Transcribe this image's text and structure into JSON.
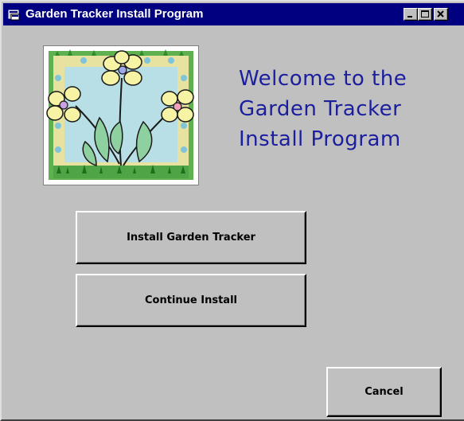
{
  "window": {
    "title": "Garden Tracker Install Program",
    "title_bg": "#000080",
    "face": "#c0c0c0"
  },
  "titlebar_buttons": {
    "minimize_icon": "minimize-icon",
    "maximize_icon": "maximize-icon",
    "close_icon": "close-icon"
  },
  "welcome": {
    "text": "Welcome to the\nGarden Tracker\nInstall Program",
    "color": "#1b1f9e"
  },
  "buttons": {
    "install_label": "Install Garden Tracker",
    "continue_label": "Continue Install",
    "cancel_label": "Cancel"
  },
  "logo": {
    "icon": "flowers-logo"
  }
}
